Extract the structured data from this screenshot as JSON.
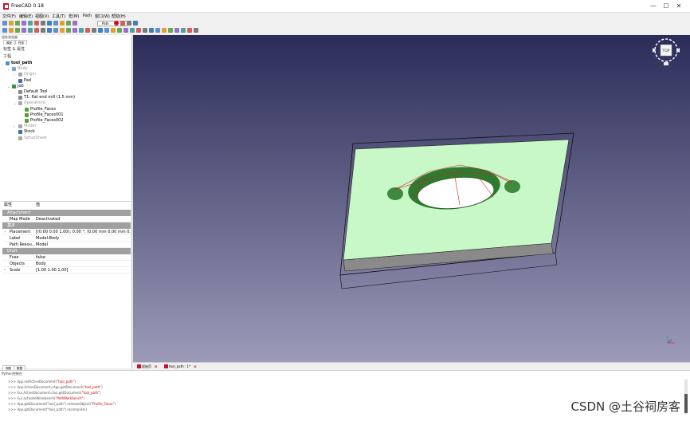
{
  "window": {
    "title": "FreeCAD 0.18",
    "min_glyph": "—",
    "max_glyph": "☐",
    "close_glyph": "✕"
  },
  "menu": [
    "文件(F)",
    "编辑(E)",
    "视图(V)",
    "工具(T)",
    "宏(M)",
    "Path",
    "窗口(W)",
    "帮助(H)"
  ],
  "toolbar": {
    "workbench_combo": "Path",
    "row1_icons": [
      "new-icon",
      "open-icon",
      "save-icon",
      "print-icon",
      "cut-icon",
      "copy-icon",
      "paste-icon",
      "undo-icon",
      "redo-icon",
      "refresh-icon",
      "whatsthis-icon",
      "workbench-icon",
      "macro-record-icon",
      "macro-stop-icon",
      "macro-edit-icon",
      "macro-run-icon"
    ],
    "row2_icons": [
      "fit-all-icon",
      "fit-selection-icon",
      "draw-style-icon",
      "sync-icon",
      "isometric-icon",
      "front-icon",
      "top-icon",
      "right-icon",
      "rear-icon",
      "bottom-icon",
      "left-icon",
      "measure-icon",
      "part-icon",
      "group-icon",
      "job-icon",
      "post-icon",
      "inspect-icon",
      "simulator-icon",
      "profile-icon",
      "pocket-icon",
      "drill-icon",
      "helix-icon",
      "face-icon",
      "engrave-icon",
      "deburr-icon",
      "dressup-icon",
      "array-icon",
      "simple-copy-icon",
      "area-icon",
      "axis-icon",
      "shape-icon"
    ]
  },
  "combo_view": {
    "title": "组合浏览器",
    "tabs": [
      "模型",
      "任务"
    ],
    "section": "标签 & 属性",
    "app_label": "工程"
  },
  "tree": [
    {
      "label": "tool_path",
      "level": 0,
      "expander": "⌄",
      "color": "#4a8fd4",
      "bold": true,
      "dim": false
    },
    {
      "label": "Body",
      "level": 1,
      "expander": "⌄",
      "color": "#7ba4cf",
      "bold": false,
      "dim": true
    },
    {
      "label": "Origin",
      "level": 2,
      "expander": "›",
      "color": "#a8a8a8",
      "bold": false,
      "dim": true
    },
    {
      "label": "Pad",
      "level": 2,
      "expander": "",
      "color": "#3a6fb0",
      "bold": false,
      "dim": false
    },
    {
      "label": "Job",
      "level": 1,
      "expander": "⌄",
      "color": "#3d8f3d",
      "bold": false,
      "dim": false
    },
    {
      "label": "Default Tool",
      "level": 2,
      "expander": "",
      "color": "#888888",
      "bold": false,
      "dim": false
    },
    {
      "label": "T1: flat end mill (1.5 mm)",
      "level": 2,
      "expander": "",
      "color": "#888888",
      "bold": false,
      "dim": false
    },
    {
      "label": "Operations",
      "level": 2,
      "expander": "⌄",
      "color": "#a8a8a8",
      "bold": false,
      "dim": true
    },
    {
      "label": "Profile_Faces",
      "level": 3,
      "expander": "",
      "color": "#5a9e3a",
      "bold": false,
      "dim": false
    },
    {
      "label": "Profile_Faces001",
      "level": 3,
      "expander": "",
      "color": "#5a9e3a",
      "bold": false,
      "dim": false
    },
    {
      "label": "Profile_Faces002",
      "level": 3,
      "expander": "",
      "color": "#5a9e3a",
      "bold": false,
      "dim": false
    },
    {
      "label": "Model",
      "level": 2,
      "expander": "›",
      "color": "#a8a8a8",
      "bold": false,
      "dim": true
    },
    {
      "label": "Stock",
      "level": 2,
      "expander": "",
      "color": "#3a6fb0",
      "bold": false,
      "dim": false
    },
    {
      "label": "SetupSheet",
      "level": 2,
      "expander": "",
      "color": "#a8a8a8",
      "bold": false,
      "dim": true
    }
  ],
  "properties": {
    "header_name": "属性",
    "header_value": "值",
    "rows": [
      {
        "kind": "group",
        "name": "Attachment"
      },
      {
        "kind": "row",
        "name": "Map Mode",
        "value": "Deactivated",
        "expandable": false
      },
      {
        "kind": "group",
        "name": "基本"
      },
      {
        "kind": "row",
        "name": "Placement",
        "value": "[(0.00 0.00 1.00); 0.00 °; (0.00 mm  0.00 mm  0.0...",
        "expandable": true
      },
      {
        "kind": "row",
        "name": "Label",
        "value": "Model-Body",
        "expandable": false
      },
      {
        "kind": "row",
        "name": "Path Resou...",
        "value": "Model",
        "expandable": false
      },
      {
        "kind": "group",
        "name": "Draft"
      },
      {
        "kind": "row",
        "name": "Fuse",
        "value": "false",
        "expandable": false
      },
      {
        "kind": "row",
        "name": "Objects",
        "value": "Body",
        "expandable": false
      },
      {
        "kind": "row",
        "name": "Scale",
        "value": "[1.00 1.00 1.00]",
        "expandable": true
      }
    ]
  },
  "property_tabs": [
    "视图",
    "数据"
  ],
  "doc_tabs": [
    {
      "label": "起始页",
      "close": "⊠"
    },
    {
      "label": "tool_path : 1*",
      "close": "⊠"
    }
  ],
  "navcube": {
    "face_label": "TOP"
  },
  "report": {
    "title": "Python控制台",
    "lines": [
      {
        "prefix": ">>> App.setActiveDocument(",
        "arg": "\"tool_path\"",
        "suffix": ")"
      },
      {
        "prefix": ">>> App.ActiveDocument=App.getDocument(",
        "arg": "\"tool_path\"",
        "suffix": ")"
      },
      {
        "prefix": ">>> Gui.ActiveDocument=Gui.getDocument(",
        "arg": "\"tool_path\"",
        "suffix": ")"
      },
      {
        "prefix": ">>> Gui.activateWorkbench(",
        "arg": "\"PathWorkbench\"",
        "suffix": ")"
      },
      {
        "prefix": ">>> App.getDocument(\"tool_path\").removeObject(",
        "arg": "\"Profile_Faces\"",
        "suffix": ")"
      },
      {
        "prefix": ">>> App.getDocument(\"tool_path\").recompute()",
        "arg": "",
        "suffix": ""
      }
    ]
  },
  "watermark": "CSDN @土谷祠房客",
  "colors": {
    "viewport_top": "#2b2c59",
    "viewport_bottom": "#9c9ab8",
    "stock_face": "#c8f7c8",
    "stock_side": "#8a8a8a",
    "toolpath": "#cc2222",
    "pocket": "#3e8a3e",
    "accent": "#c8102e"
  }
}
